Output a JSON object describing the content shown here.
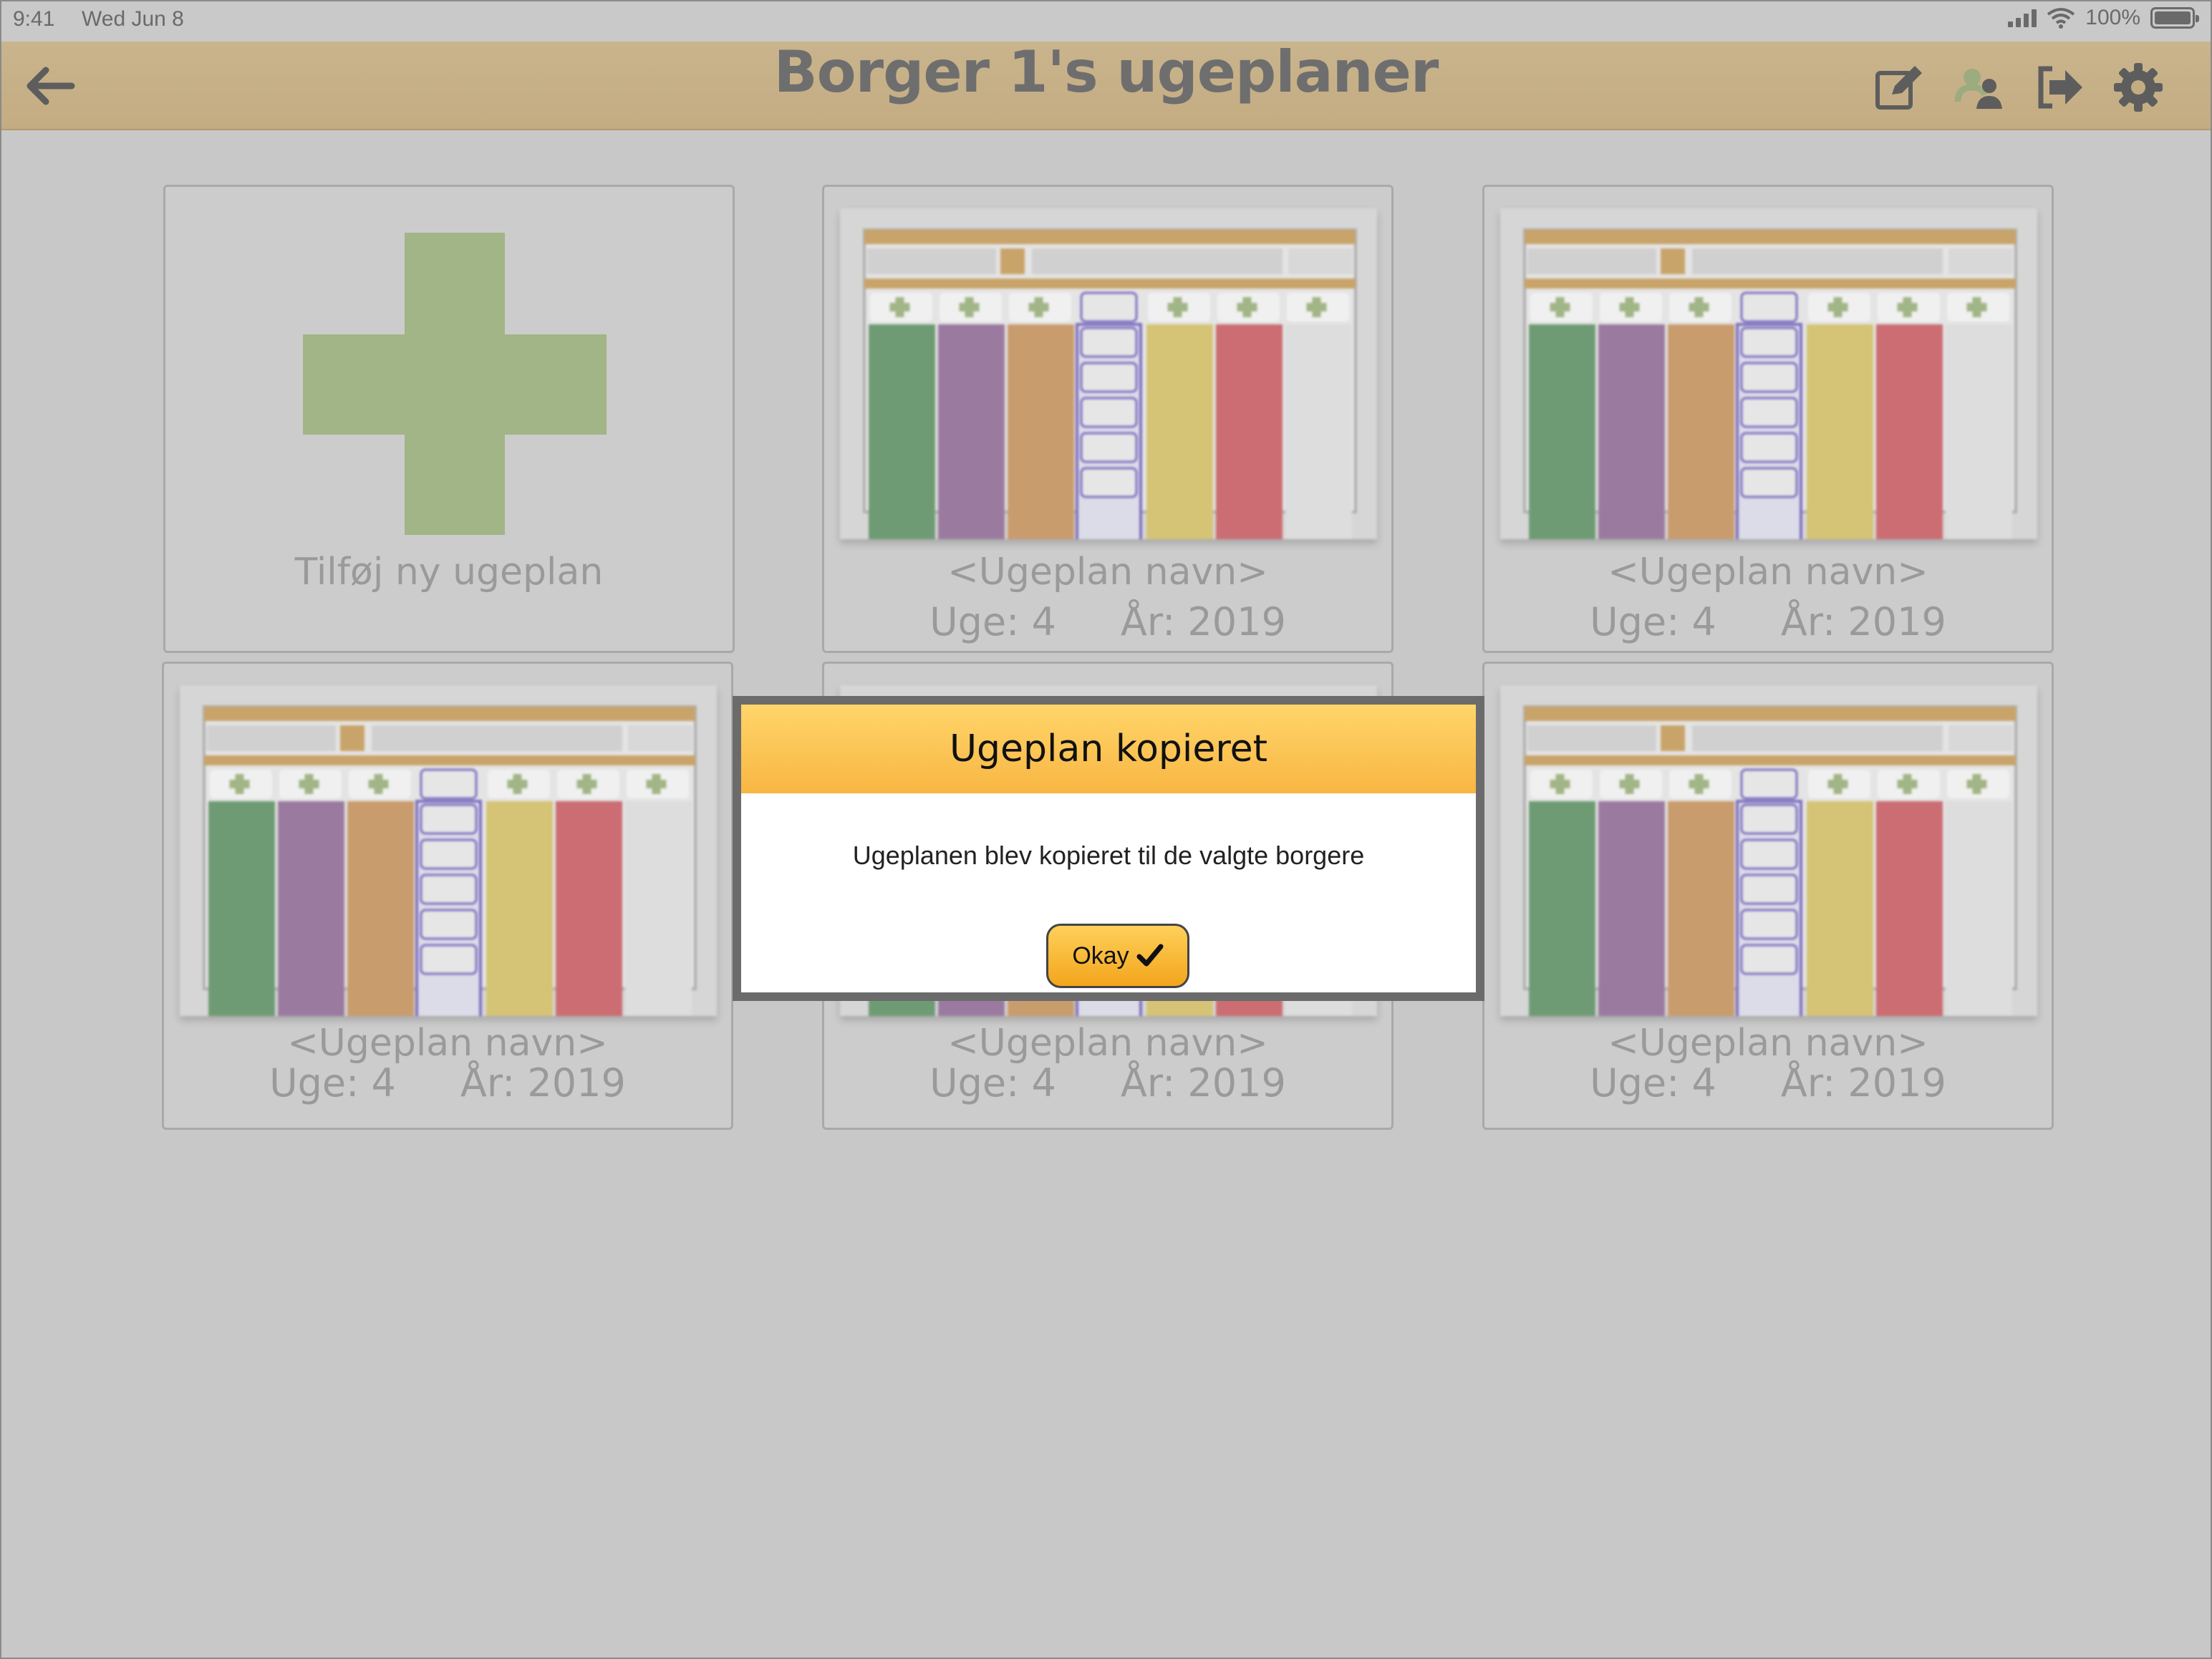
{
  "status_bar": {
    "time": "9:41",
    "date": "Wed Jun 8",
    "battery": "100%"
  },
  "header": {
    "title": "Borger 1's ugeplaner",
    "icons": [
      "back-arrow-icon",
      "edit-icon",
      "copy-to-users-icon",
      "logout-icon",
      "settings-gear-icon"
    ]
  },
  "add_card": {
    "label": "Tilføj ny ugeplan"
  },
  "cards": [
    {
      "name": "<Ugeplan navn>",
      "week": "Uge: 4",
      "year": "År: 2019"
    },
    {
      "name": "<Ugeplan navn>",
      "week": "Uge: 4",
      "year": "År: 2019"
    },
    {
      "name": "<Ugeplan navn>",
      "week": "Uge: 4",
      "year": "År: 2019"
    },
    {
      "name": "<Ugeplan navn>",
      "week": "Uge: 4",
      "year": "År: 2019"
    },
    {
      "name": "<Ugeplan navn>",
      "week": "Uge: 4",
      "year": "År: 2019"
    }
  ],
  "thumbnail": {
    "day_colors": [
      "#6f9b74",
      "#9b7aa0",
      "#c99c6d",
      "#d0d0d0",
      "#d5c475",
      "#cb6d72",
      "#dddddd"
    ]
  },
  "modal": {
    "title": "Ugeplan kopieret",
    "message": "Ugeplanen blev kopieret til de valgte borgere",
    "button_label": "Okay"
  }
}
